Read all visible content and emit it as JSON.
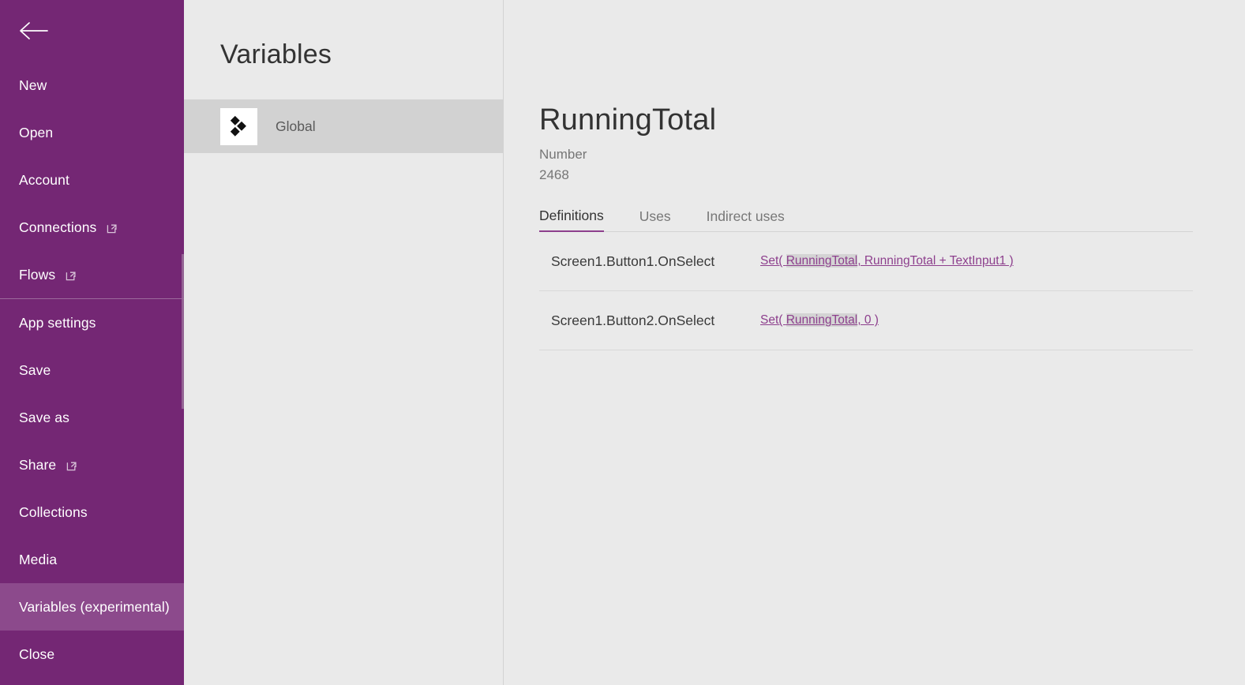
{
  "sidebar": {
    "back_icon": "back-arrow-icon",
    "items": [
      {
        "label": "New",
        "external": false,
        "selected": false,
        "divider_after": false
      },
      {
        "label": "Open",
        "external": false,
        "selected": false,
        "divider_after": false
      },
      {
        "label": "Account",
        "external": false,
        "selected": false,
        "divider_after": false
      },
      {
        "label": "Connections",
        "external": true,
        "selected": false,
        "divider_after": false
      },
      {
        "label": "Flows",
        "external": true,
        "selected": false,
        "divider_after": true
      },
      {
        "label": "App settings",
        "external": false,
        "selected": false,
        "divider_after": false
      },
      {
        "label": "Save",
        "external": false,
        "selected": false,
        "divider_after": false
      },
      {
        "label": "Save as",
        "external": false,
        "selected": false,
        "divider_after": false
      },
      {
        "label": "Share",
        "external": true,
        "selected": false,
        "divider_after": false
      },
      {
        "label": "Collections",
        "external": false,
        "selected": false,
        "divider_after": false
      },
      {
        "label": "Media",
        "external": false,
        "selected": false,
        "divider_after": false
      },
      {
        "label": "Variables (experimental)",
        "external": false,
        "selected": true,
        "divider_after": false
      },
      {
        "label": "Close",
        "external": false,
        "selected": false,
        "divider_after": false
      }
    ],
    "colors": {
      "background": "#742774",
      "selected": "#8c4a8c",
      "divider": "#9c6a9c",
      "text": "#ffffff"
    }
  },
  "list_pane": {
    "title": "Variables",
    "rows": [
      {
        "label": "Global",
        "icon": "variables-diamonds-icon",
        "selected": true
      }
    ]
  },
  "detail": {
    "title": "RunningTotal",
    "type": "Number",
    "value": "2468",
    "tabs": [
      {
        "label": "Definitions",
        "active": true
      },
      {
        "label": "Uses",
        "active": false
      },
      {
        "label": "Indirect uses",
        "active": false
      }
    ],
    "definitions": [
      {
        "target": "Screen1.Button1.OnSelect",
        "formula_pre": "Set( ",
        "formula_highlight": "RunningTotal",
        "formula_post": ", RunningTotal + TextInput1 )"
      },
      {
        "target": "Screen1.Button2.OnSelect",
        "formula_pre": "Set( ",
        "formula_highlight": "RunningTotal",
        "formula_post": ", 0 )"
      }
    ],
    "colors": {
      "accent": "#8d3f8d",
      "link": "#8d3f8d",
      "highlight": "#d4d4d4",
      "background": "#eaeaea"
    }
  }
}
